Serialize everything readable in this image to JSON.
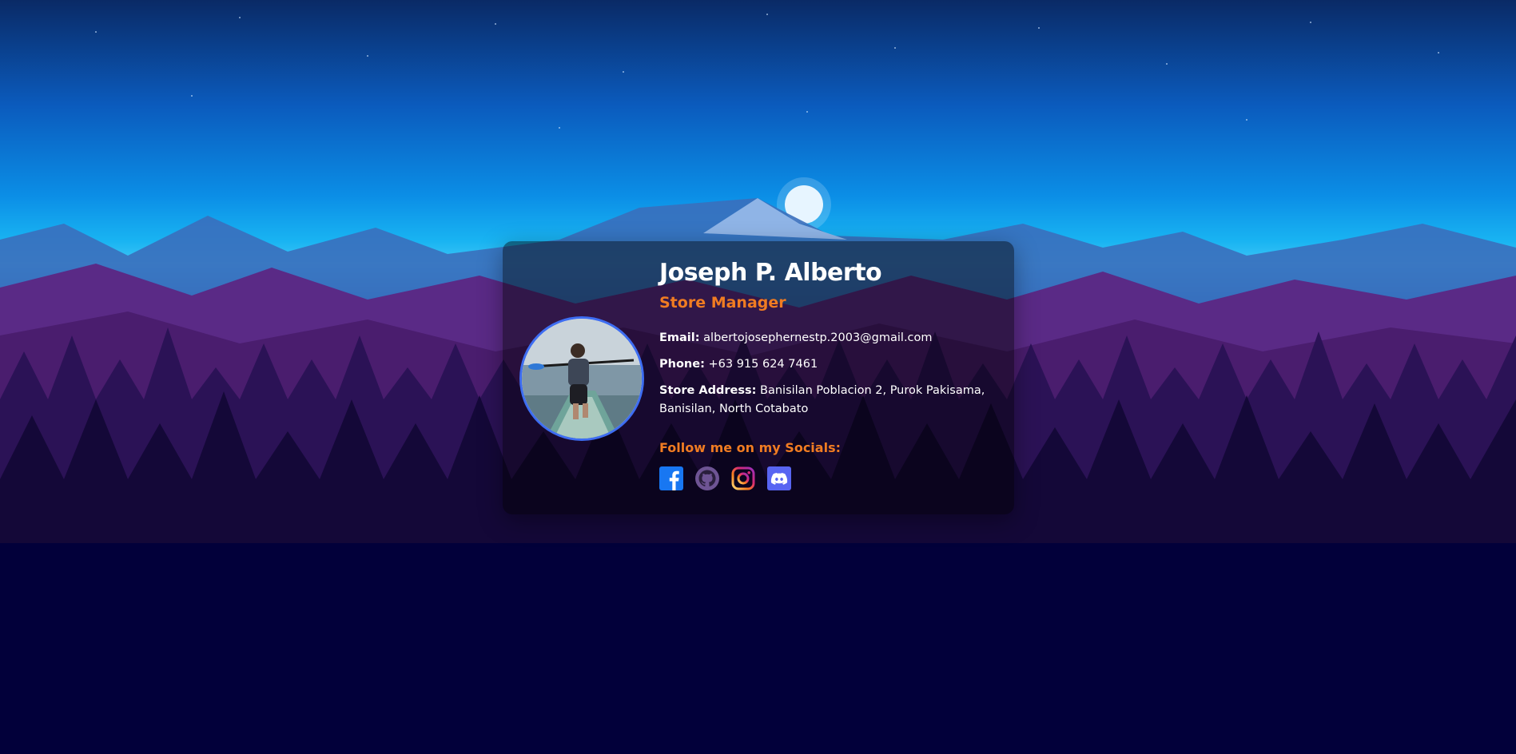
{
  "profile": {
    "name": "Joseph P. Alberto",
    "title": "Store Manager",
    "email_label": "Email:",
    "email": "albertojosephernestp.2003@gmail.com",
    "phone_label": "Phone:",
    "phone": "+63 915 624 7461",
    "address_label": "Store Address:",
    "address": "Banisilan Poblacion 2, Purok Pakisama, Banisilan, North Cotabato",
    "socials_label": "Follow me on my Socials:",
    "socials": [
      {
        "name": "facebook-icon",
        "color": "#1877f2"
      },
      {
        "name": "github-icon",
        "color": "#6e5494"
      },
      {
        "name": "instagram-icon",
        "color": "#e1306c"
      },
      {
        "name": "discord-icon",
        "color": "#5865f2"
      }
    ]
  },
  "colors": {
    "accent": "#f07c22",
    "avatar_border": "#3d6df2",
    "background_bottom": "#02003a"
  }
}
